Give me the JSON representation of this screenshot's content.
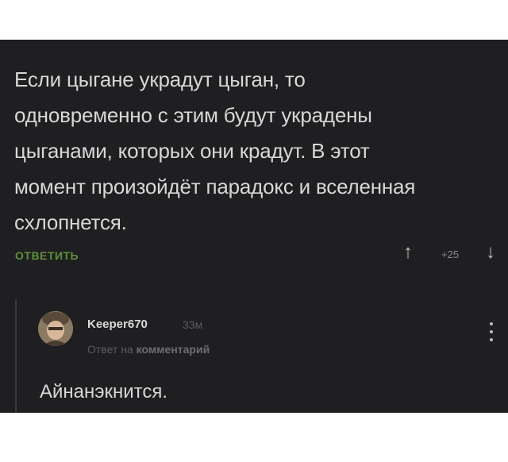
{
  "post": {
    "lines": [
      "Если цыгане украдут цыган, то",
      "одновременно с этим будут украдены",
      "цыганами, которых они крадут. В этот",
      "момент произойдёт парадокс и вселенная",
      "схлопнется."
    ],
    "reply_label": "ОТВЕТИТЬ",
    "score": "+25",
    "upvote_icon": "↑",
    "downvote_icon": "↓"
  },
  "reply": {
    "username": "Keeper670",
    "time": "33м",
    "reply_to_prefix": "Ответ на",
    "reply_to_target": "комментарий",
    "text": "Айнанэкнится."
  },
  "colors": {
    "panel_bg": "#1f1f22",
    "text": "#d7d7d7",
    "accent_green": "#5f8f3a",
    "muted": "#5b5b5e"
  }
}
